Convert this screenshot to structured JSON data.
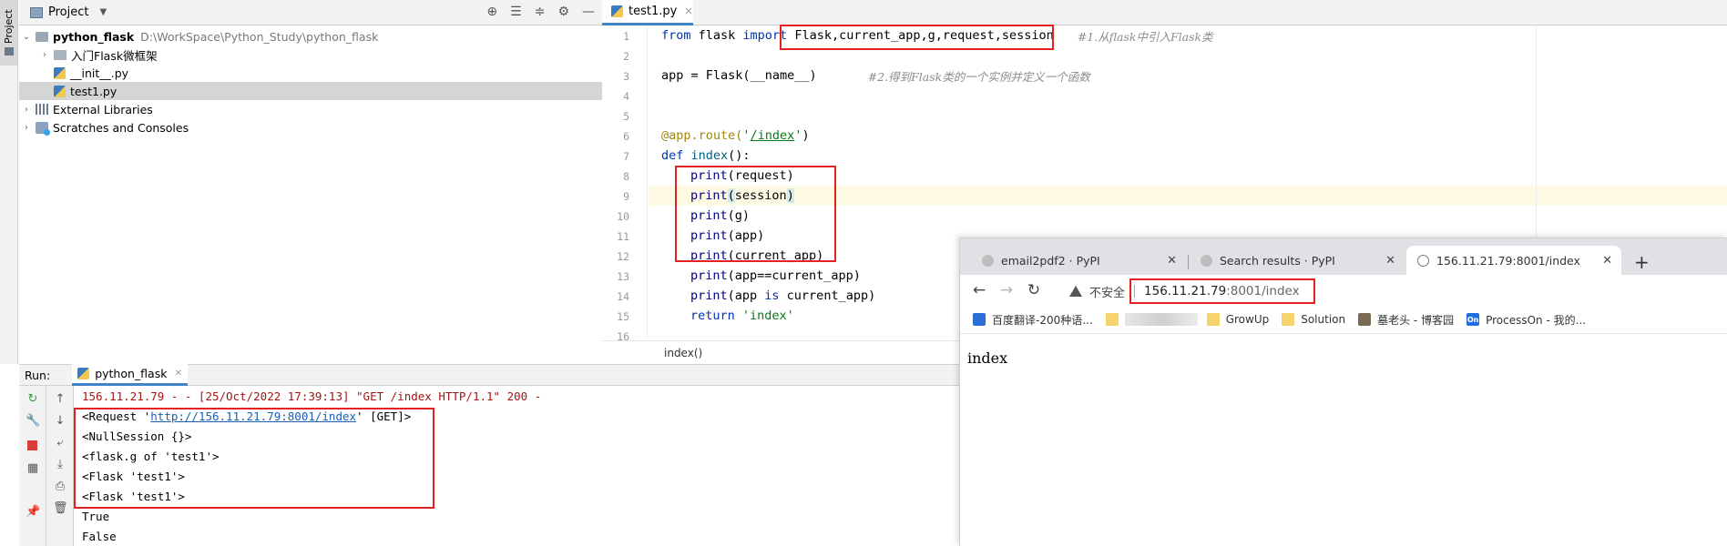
{
  "toolstrip": {
    "project_tab": "Project"
  },
  "project_panel": {
    "title": "Project",
    "tree": [
      {
        "name": "python_flask",
        "path": "D:\\WorkSpace\\Python_Study\\python_flask"
      },
      {
        "name": "入门Flask微框架"
      },
      {
        "name": "__init__.py"
      },
      {
        "name": "test1.py"
      },
      {
        "name": "External Libraries"
      },
      {
        "name": "Scratches and Consoles"
      }
    ]
  },
  "editor": {
    "tab_label": "test1.py",
    "line_numbers": [
      "1",
      "2",
      "3",
      "4",
      "5",
      "6",
      "7",
      "8",
      "9",
      "10",
      "11",
      "12",
      "13",
      "14",
      "15",
      "16"
    ],
    "lines": {
      "l1_kw1": "from",
      "l1_mod": " flask ",
      "l1_kw2": "import",
      "l1_names": " Flask,current_app,g,request,session",
      "l1_cmt": "#1.从flask中引入Flask类",
      "l3_code": "app = Flask(__name__)",
      "l3_cmt": "#2.得到Flask类的一个实例并定义一个函数",
      "l6_deco": "@app.route(",
      "l6_q1": "'",
      "l6_path": "/index",
      "l6_q2": "'",
      "l6_close": ")",
      "l7_kw": "def",
      "l7_fn": "index",
      "l7_rest": "():",
      "l8_fn": "print",
      "l8_rest": "(request)",
      "l9_fn": "print",
      "l9_open": "(",
      "l9_arg": "session",
      "l9_close": ")",
      "l10_fn": "print",
      "l10_rest": "(g)",
      "l11_fn": "print",
      "l11_rest": "(app)",
      "l12_fn": "print",
      "l12_rest": "(current_app)",
      "l13_fn": "print",
      "l13_rest": "(app==current_app)",
      "l14_fn": "print",
      "l14_a": "(app ",
      "l14_kw": "is",
      "l14_b": " current_app)",
      "l15_kw": "return",
      "l15_str": " 'index'"
    },
    "breadcrumb": "index()"
  },
  "run_panel": {
    "label": "Run:",
    "tab_label": "python_flask",
    "console": {
      "log": "156.11.21.79 - - [25/Oct/2022 17:39:13] \"GET /index HTTP/1.1\" 200 -",
      "req_prefix": "<Request '",
      "req_link": "http://156.11.21.79:8001/index",
      "req_suffix": "' [GET]>",
      "session": "<NullSession {}>",
      "g": "<flask.g of 'test1'>",
      "app1": "<Flask 'test1'>",
      "app2": "<Flask 'test1'>",
      "true": "True",
      "false": "False"
    }
  },
  "browser": {
    "tabs": [
      {
        "label": "email2pdf2 · PyPI"
      },
      {
        "label": "Search results · PyPI"
      },
      {
        "label": "156.11.21.79:8001/index"
      }
    ],
    "address": {
      "insecure_label": "不安全",
      "host": "156.11.21.79",
      "rest": ":8001/index"
    },
    "bookmarks": [
      {
        "label": "百度翻译-200种语..."
      },
      {
        "label": "GrowUp"
      },
      {
        "label": "Solution"
      },
      {
        "label": "墓老头 - 博客园"
      },
      {
        "label": "ProcessOn - 我的..."
      }
    ],
    "bookmark_on_badge": "On",
    "page_text": "index"
  },
  "colors": {
    "highlight_box": "#e62121",
    "keyword": "#0033b3",
    "string": "#067d17",
    "comment": "#8c8c8c"
  }
}
